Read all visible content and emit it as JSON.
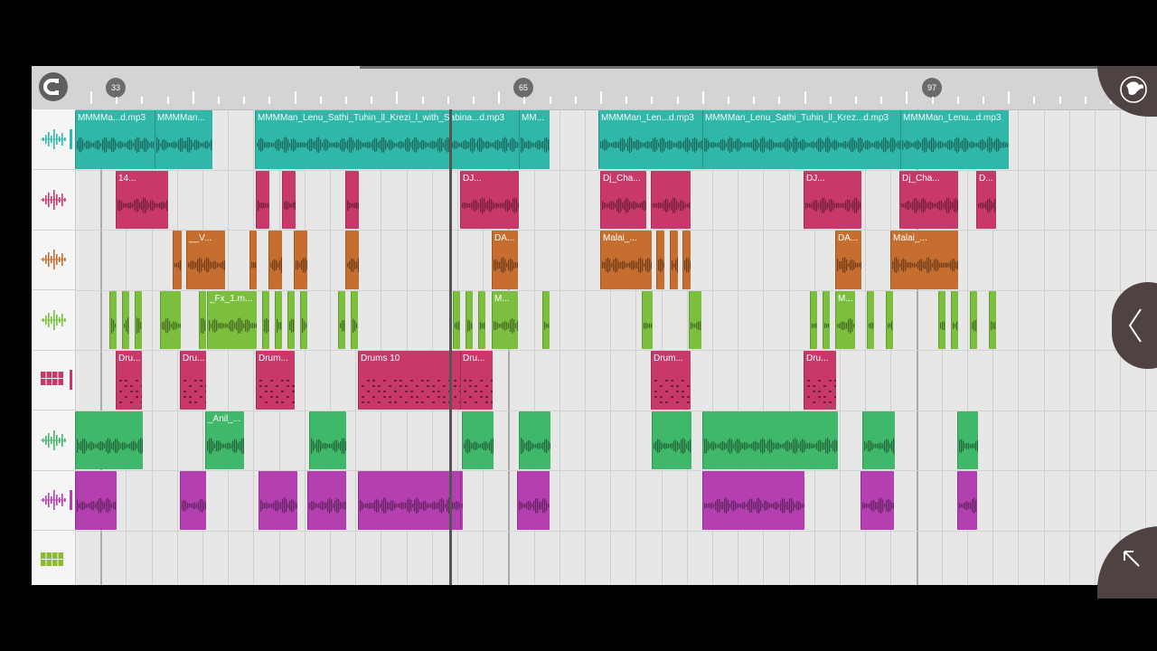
{
  "ruler": {
    "bar_labels": [
      "33",
      "65",
      "97"
    ]
  },
  "tracks": [
    {
      "type": "audio",
      "color": "#2fb7a8",
      "icon": "waveform-icon"
    },
    {
      "type": "audio",
      "color": "#c9386a",
      "icon": "waveform-icon"
    },
    {
      "type": "audio",
      "color": "#c66e2f",
      "icon": "waveform-icon"
    },
    {
      "type": "audio",
      "color": "#7cbf3f",
      "icon": "waveform-icon"
    },
    {
      "type": "drums",
      "color": "#c9386a",
      "icon": "drum-pads-icon"
    },
    {
      "type": "audio",
      "color": "#3fb86a",
      "icon": "waveform-icon"
    },
    {
      "type": "audio",
      "color": "#b43fb0",
      "icon": "waveform-icon"
    },
    {
      "type": "drums",
      "color": "#8dbb2f",
      "icon": "drum-pads-icon"
    }
  ],
  "clips": [
    {
      "track": 0,
      "start": 0,
      "end": 88,
      "label": "MMMMa...d.mp3"
    },
    {
      "track": 0,
      "start": 88,
      "end": 151,
      "label": "MMMMan..."
    },
    {
      "track": 0,
      "start": 199,
      "end": 524,
      "label": "MMMMan_Lenu_Sathi_Tuhin_ll_Krezi_l_with_Sabina...d.mp3"
    },
    {
      "track": 0,
      "start": 491,
      "end": 524,
      "label": "MM..."
    },
    {
      "track": 0,
      "start": 579,
      "end": 1032,
      "label": "MMMMan_Len...d.mp3"
    },
    {
      "track": 0,
      "start": 694,
      "end": 1032,
      "label": "MMMMan_Lenu_Sathi_Tuhin_ll_Krez...d.mp3"
    },
    {
      "track": 0,
      "start": 913,
      "end": 1032,
      "label": "MMMMan_Lenu...d.mp3"
    },
    {
      "track": 1,
      "start": 45,
      "end": 102,
      "label": "14..."
    },
    {
      "track": 1,
      "start": 200,
      "end": 214,
      "label": ""
    },
    {
      "track": 1,
      "start": 229,
      "end": 243,
      "label": ""
    },
    {
      "track": 1,
      "start": 299,
      "end": 313,
      "label": ""
    },
    {
      "track": 1,
      "start": 426,
      "end": 490,
      "label": "DJ..."
    },
    {
      "track": 1,
      "start": 581,
      "end": 631,
      "label": "Dj_Cha..."
    },
    {
      "track": 1,
      "start": 637,
      "end": 680,
      "label": ""
    },
    {
      "track": 1,
      "start": 806,
      "end": 869,
      "label": "DJ..."
    },
    {
      "track": 1,
      "start": 912,
      "end": 976,
      "label": "Dj_Cha..."
    },
    {
      "track": 1,
      "start": 997,
      "end": 1018,
      "label": "D..."
    },
    {
      "track": 2,
      "start": 108,
      "end": 117,
      "label": ""
    },
    {
      "track": 2,
      "start": 123,
      "end": 165,
      "label": "__V..."
    },
    {
      "track": 2,
      "start": 193,
      "end": 200,
      "label": ""
    },
    {
      "track": 2,
      "start": 214,
      "end": 228,
      "label": ""
    },
    {
      "track": 2,
      "start": 242,
      "end": 256,
      "label": ""
    },
    {
      "track": 2,
      "start": 299,
      "end": 313,
      "label": ""
    },
    {
      "track": 2,
      "start": 461,
      "end": 489,
      "label": "DA..."
    },
    {
      "track": 2,
      "start": 581,
      "end": 637,
      "label": "Malai_..."
    },
    {
      "track": 2,
      "start": 643,
      "end": 651,
      "label": ""
    },
    {
      "track": 2,
      "start": 658,
      "end": 666,
      "label": ""
    },
    {
      "track": 2,
      "start": 672,
      "end": 680,
      "label": ""
    },
    {
      "track": 2,
      "start": 841,
      "end": 869,
      "label": "DA..."
    },
    {
      "track": 2,
      "start": 902,
      "end": 976,
      "label": "Malai_..."
    },
    {
      "track": 3,
      "start": 38,
      "end": 45,
      "label": ""
    },
    {
      "track": 3,
      "start": 52,
      "end": 59,
      "label": ""
    },
    {
      "track": 3,
      "start": 66,
      "end": 73,
      "label": ""
    },
    {
      "track": 3,
      "start": 94,
      "end": 116,
      "label": ""
    },
    {
      "track": 3,
      "start": 137,
      "end": 144,
      "label": ""
    },
    {
      "track": 3,
      "start": 146,
      "end": 200,
      "label": "_Fx_1.m..."
    },
    {
      "track": 3,
      "start": 207,
      "end": 214,
      "label": ""
    },
    {
      "track": 3,
      "start": 221,
      "end": 228,
      "label": ""
    },
    {
      "track": 3,
      "start": 235,
      "end": 242,
      "label": ""
    },
    {
      "track": 3,
      "start": 249,
      "end": 256,
      "label": ""
    },
    {
      "track": 3,
      "start": 291,
      "end": 298,
      "label": ""
    },
    {
      "track": 3,
      "start": 305,
      "end": 312,
      "label": ""
    },
    {
      "track": 3,
      "start": 418,
      "end": 425,
      "label": ""
    },
    {
      "track": 3,
      "start": 432,
      "end": 439,
      "label": ""
    },
    {
      "track": 3,
      "start": 446,
      "end": 453,
      "label": ""
    },
    {
      "track": 3,
      "start": 461,
      "end": 489,
      "label": "M..."
    },
    {
      "track": 3,
      "start": 517,
      "end": 524,
      "label": ""
    },
    {
      "track": 3,
      "start": 627,
      "end": 638,
      "label": ""
    },
    {
      "track": 3,
      "start": 679,
      "end": 692,
      "label": ""
    },
    {
      "track": 3,
      "start": 813,
      "end": 820,
      "label": ""
    },
    {
      "track": 3,
      "start": 827,
      "end": 834,
      "label": ""
    },
    {
      "track": 3,
      "start": 841,
      "end": 862,
      "label": "M..."
    },
    {
      "track": 3,
      "start": 876,
      "end": 883,
      "label": ""
    },
    {
      "track": 3,
      "start": 897,
      "end": 904,
      "label": ""
    },
    {
      "track": 3,
      "start": 955,
      "end": 962,
      "label": ""
    },
    {
      "track": 3,
      "start": 969,
      "end": 976,
      "label": ""
    },
    {
      "track": 3,
      "start": 990,
      "end": 997,
      "label": ""
    },
    {
      "track": 3,
      "start": 1011,
      "end": 1018,
      "label": ""
    },
    {
      "track": 4,
      "start": 45,
      "end": 73,
      "label": "Dru..."
    },
    {
      "track": 4,
      "start": 116,
      "end": 144,
      "label": "Dru..."
    },
    {
      "track": 4,
      "start": 200,
      "end": 242,
      "label": "Drum..."
    },
    {
      "track": 4,
      "start": 313,
      "end": 426,
      "label": "Drums 10"
    },
    {
      "track": 4,
      "start": 426,
      "end": 461,
      "label": ""
    },
    {
      "track": 4,
      "start": 426,
      "end": 461,
      "label": "Dru..."
    },
    {
      "track": 4,
      "start": 637,
      "end": 680,
      "label": "Drum..."
    },
    {
      "track": 4,
      "start": 806,
      "end": 841,
      "label": "Dru..."
    },
    {
      "track": 5,
      "start": 0,
      "end": 74,
      "label": ""
    },
    {
      "track": 5,
      "start": 144,
      "end": 186,
      "label": "_Anil_..."
    },
    {
      "track": 5,
      "start": 259,
      "end": 299,
      "label": ""
    },
    {
      "track": 5,
      "start": 428,
      "end": 462,
      "label": ""
    },
    {
      "track": 5,
      "start": 491,
      "end": 525,
      "label": ""
    },
    {
      "track": 5,
      "start": 638,
      "end": 681,
      "label": ""
    },
    {
      "track": 5,
      "start": 694,
      "end": 843,
      "label": ""
    },
    {
      "track": 5,
      "start": 871,
      "end": 906,
      "label": ""
    },
    {
      "track": 5,
      "start": 976,
      "end": 998,
      "label": ""
    },
    {
      "track": 6,
      "start": 0,
      "end": 45,
      "label": ""
    },
    {
      "track": 6,
      "start": 116,
      "end": 144,
      "label": ""
    },
    {
      "track": 6,
      "start": 203,
      "end": 245,
      "label": ""
    },
    {
      "track": 6,
      "start": 257,
      "end": 299,
      "label": ""
    },
    {
      "track": 6,
      "start": 313,
      "end": 426,
      "label": ""
    },
    {
      "track": 6,
      "start": 426,
      "end": 426,
      "label": ""
    },
    {
      "track": 6,
      "start": 489,
      "end": 524,
      "label": ""
    },
    {
      "track": 6,
      "start": 694,
      "end": 806,
      "label": ""
    },
    {
      "track": 6,
      "start": 869,
      "end": 905,
      "label": ""
    },
    {
      "track": 6,
      "start": 976,
      "end": 997,
      "label": ""
    }
  ]
}
